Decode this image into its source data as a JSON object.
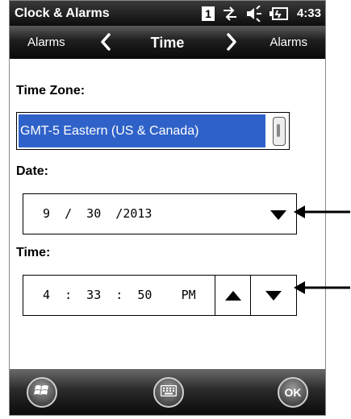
{
  "status_bar": {
    "app_title": "Clock & Alarms",
    "sim_number": "1",
    "time": "4:33"
  },
  "tab_bar": {
    "prev_label": "Alarms",
    "current_label": "Time",
    "next_label": "Alarms"
  },
  "time_zone": {
    "label": "Time Zone:",
    "selected": "GMT-5 Eastern (US & Canada)"
  },
  "date": {
    "label": "Date:",
    "value": "9  /  30  /2013"
  },
  "time": {
    "label": "Time:",
    "value": "4  :  33  :  50    PM"
  },
  "menu_bar": {
    "ok_label": "OK"
  },
  "colors": {
    "selection": "#2f62c8",
    "bar_dark": "#0d0d0d"
  },
  "icons": [
    "sync-icon",
    "speaker-icon",
    "battery-charging-icon",
    "chevron-left-icon",
    "chevron-right-icon",
    "dropdown-arrow-icon",
    "up-arrow-icon",
    "down-arrow-icon",
    "windows-start-icon",
    "keyboard-icon",
    "callout-arrow-icon"
  ]
}
